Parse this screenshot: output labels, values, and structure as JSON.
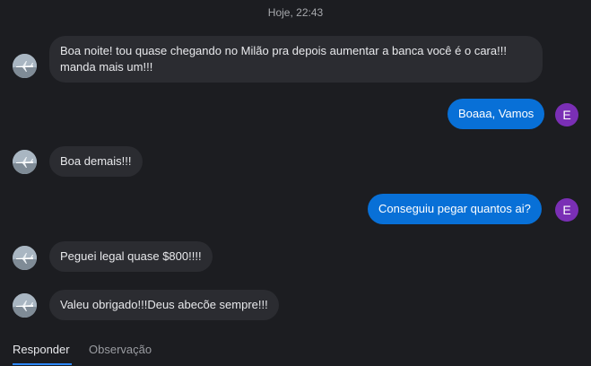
{
  "chat": {
    "timestamp": "Hoje, 22:43",
    "messages": [
      {
        "direction": "incoming",
        "text": "Boa noite! tou quase chegando no Milão pra depois aumentar a banca você é o cara!!! manda mais um!!!"
      },
      {
        "direction": "outgoing",
        "text": "Boaaa, Vamos",
        "avatar_initial": "E"
      },
      {
        "direction": "incoming",
        "text": "Boa demais!!!"
      },
      {
        "direction": "outgoing",
        "text": "Conseguiu pegar quantos ai?",
        "avatar_initial": "E"
      },
      {
        "direction": "incoming",
        "text": "Peguei legal quase $800!!!!"
      },
      {
        "direction": "incoming",
        "text": "Valeu obrigado!!!Deus abecõe sempre!!!"
      }
    ]
  },
  "tabs": {
    "reply_label": "Responder",
    "note_label": "Observação"
  },
  "colors": {
    "background": "#1c1d21",
    "incoming_bubble": "#2b2c31",
    "outgoing_bubble": "#0870d7",
    "user_avatar": "#7a2fb5",
    "active_tab_underline": "#2d88ff"
  },
  "icons": {
    "contact_avatar": "airplane-avatar-icon"
  }
}
